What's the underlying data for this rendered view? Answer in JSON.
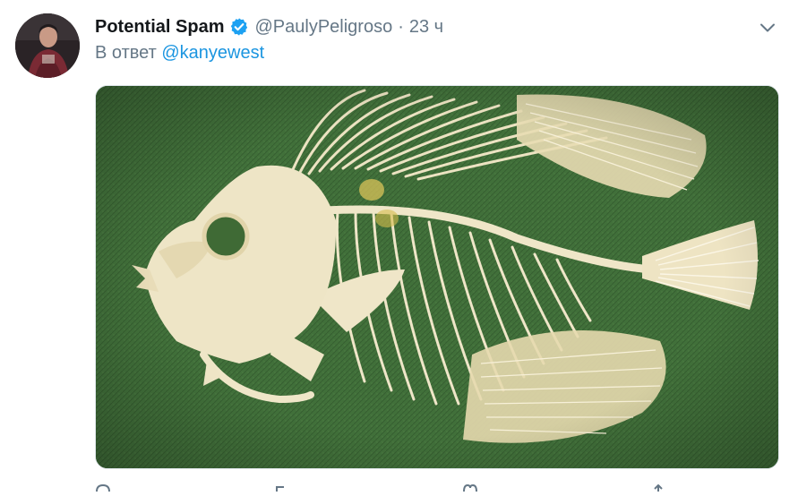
{
  "tweet": {
    "display_name": "Potential Spam",
    "handle": "@PaulyPeligroso",
    "separator": "·",
    "time": "23 ч",
    "reply_prefix": "В ответ",
    "reply_mention": "@kanyewest"
  },
  "icons": {
    "verified": "verified-badge-icon",
    "more": "chevron-down-icon"
  },
  "colors": {
    "link": "#1b95e0",
    "muted": "#657786",
    "verified": "#1da1f2",
    "felt_background": "#3f6a35",
    "bone": "#efe6c8"
  }
}
